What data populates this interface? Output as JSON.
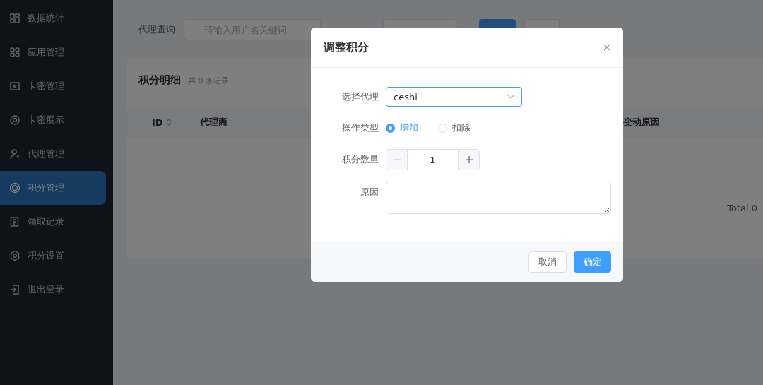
{
  "sidebar": {
    "items": [
      {
        "label": "数据统计",
        "kind": "dashboard",
        "selected": false
      },
      {
        "label": "应用管理",
        "kind": "apps",
        "selected": false
      },
      {
        "label": "卡密管理",
        "kind": "card",
        "selected": false
      },
      {
        "label": "卡密展示",
        "kind": "eye",
        "selected": false
      },
      {
        "label": "代理管理",
        "kind": "user",
        "selected": false
      },
      {
        "label": "积分管理",
        "kind": "coin",
        "selected": true
      },
      {
        "label": "领取记录",
        "kind": "document",
        "selected": false
      },
      {
        "label": "积分设置",
        "kind": "gear",
        "selected": false
      },
      {
        "label": "退出登录",
        "kind": "logout",
        "selected": false
      }
    ]
  },
  "filters": {
    "agent_label": "代理查询",
    "agent_placeholder": "请输入用户名关键词"
  },
  "card": {
    "title": "积分明细",
    "count": "共 0 条记录",
    "columns": [
      {
        "label": "ID",
        "sortable": true
      },
      {
        "label": "代理商",
        "sortable": false
      },
      {
        "label": "变动原因",
        "sortable": false
      }
    ],
    "total": "Total 0"
  },
  "dialog": {
    "title": "调整积分",
    "fields": {
      "agent_label": "选择代理",
      "agent_value": "ceshi",
      "type_label": "操作类型",
      "type_options": [
        {
          "label": "增加",
          "selected": true
        },
        {
          "label": "扣除",
          "selected": false
        }
      ],
      "amount_label": "积分数量",
      "amount_value": "1",
      "amount_minus_disabled": true,
      "reason_label": "原因"
    },
    "cancel_button": "取消",
    "confirm_button": "确定"
  }
}
